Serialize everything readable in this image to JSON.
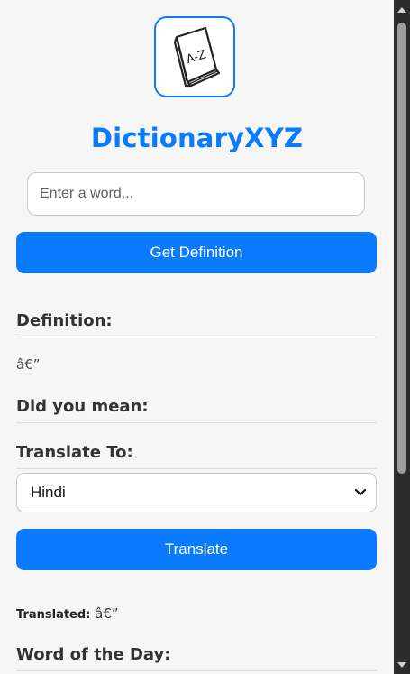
{
  "app": {
    "title": "DictionaryXYZ",
    "logo_icon": "book-a-z-icon",
    "logo_text": "A-Z",
    "accent_color": "#0a7bff"
  },
  "search": {
    "placeholder": "Enter a word...",
    "value": ""
  },
  "buttons": {
    "get_definition": "Get Definition",
    "translate": "Translate"
  },
  "sections": {
    "definition_heading": "Definition:",
    "definition_text": "â€”",
    "did_you_mean_heading": "Did you mean:",
    "translate_heading": "Translate To:",
    "word_of_day_heading": "Word of the Day:"
  },
  "translate": {
    "selected_language": "Hindi",
    "dropdown_icon": "chevron-down-icon",
    "translated_label": "Translated:",
    "translated_value": "â€”"
  },
  "scrollbar": {
    "up_icon": "scroll-up-arrow-icon",
    "down_icon": "scroll-down-arrow-icon"
  }
}
